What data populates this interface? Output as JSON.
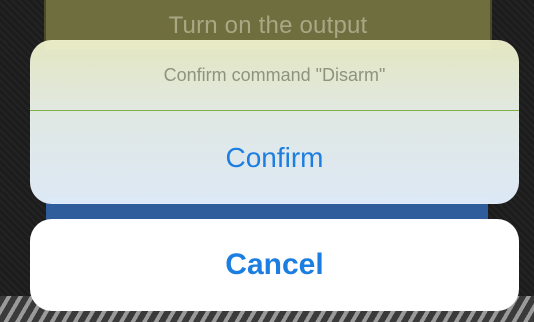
{
  "background": {
    "output_label": "Turn on the output"
  },
  "action_sheet": {
    "message": "Confirm command \"Disarm\"",
    "confirm_label": "Confirm",
    "cancel_label": "Cancel"
  },
  "colors": {
    "action_blue": "#1b7ee0",
    "divider_green": "#7fb14a",
    "sheet_message_gray": "#8f937e",
    "background_dark": "#1c1c1c"
  }
}
